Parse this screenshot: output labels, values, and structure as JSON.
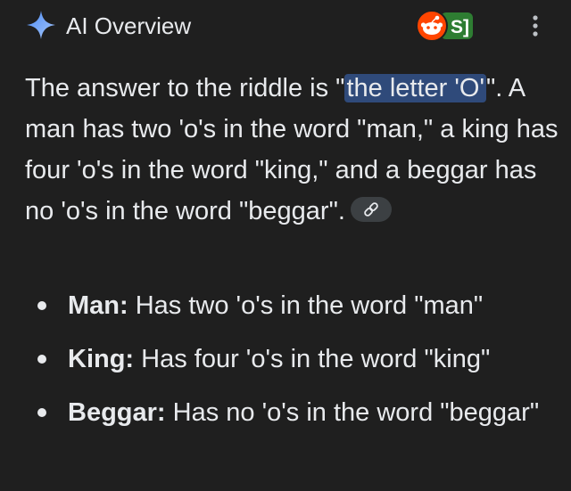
{
  "header": {
    "title": "AI Overview",
    "icon": "sparkle-icon",
    "sources": [
      "reddit-icon",
      "s-bracket-icon"
    ],
    "menu_icon": "more-vert-icon"
  },
  "answer": {
    "text_before": "The answer to the riddle is \"",
    "highlight": "the letter 'O'",
    "text_after": "\". A man has two 'o's in the word \"man,\" a king has four 'o's in the word \"king,\" and a beggar has no 'o's in the word \"beggar\".",
    "link_icon": "link-icon"
  },
  "bullets": [
    {
      "term": "Man:",
      "text": " Has two 'o's in the word \"man\""
    },
    {
      "term": "King:",
      "text": " Has four 'o's in the word \"king\""
    },
    {
      "term": "Beggar:",
      "text": " Has no 'o's in the word \"beggar\""
    }
  ],
  "colors": {
    "background": "#1f1f1f",
    "text": "#e8eaed",
    "highlight": "#2f4a7a",
    "reddit": "#ff4500",
    "sparkle": "#8ab4f8"
  }
}
